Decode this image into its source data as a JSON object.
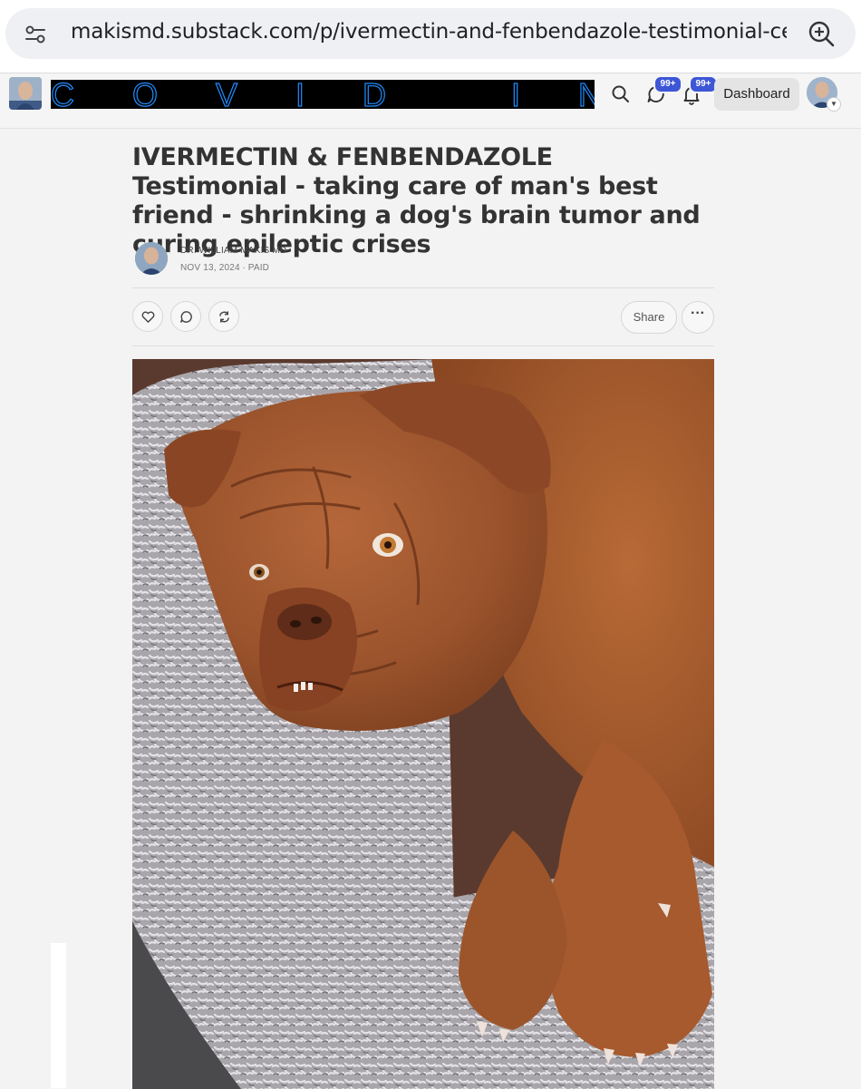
{
  "browser": {
    "url": "makismd.substack.com/p/ivermectin-and-fenbendazole-testimonial-cec",
    "site_settings_icon": "tune-icon",
    "zoom_icon": "zoom-in-icon"
  },
  "nav": {
    "publication_avatar": "author-photo",
    "banner_text": "COVID INTE",
    "search_icon": "search-icon",
    "chat_icon": "chat-bubble-icon",
    "chat_badge": "99+",
    "notifications_icon": "bell-icon",
    "notifications_badge": "99+",
    "dashboard_label": "Dashboard",
    "user_menu_icon": "chevron-down-icon"
  },
  "article": {
    "title": "IVERMECTIN & FENBENDAZOLE Testimonial - taking care of man's best friend - shrinking a dog's brain tumor and curing epileptic crises",
    "author": "DR. WILLIAM MAKIS MD",
    "meta": "NOV 13, 2024 ∙ PAID",
    "actions": {
      "like_icon": "heart-icon",
      "comment_icon": "comment-icon",
      "restack_icon": "restack-icon",
      "share_label": "Share",
      "more_label": "···"
    },
    "hero_image": "dog-lying-on-shaggy-bed"
  },
  "colors": {
    "badge": "#3d56d6",
    "banner_text": "#1f8cff",
    "banner_bg": "#000000",
    "page_bg": "#f3f3f3"
  }
}
